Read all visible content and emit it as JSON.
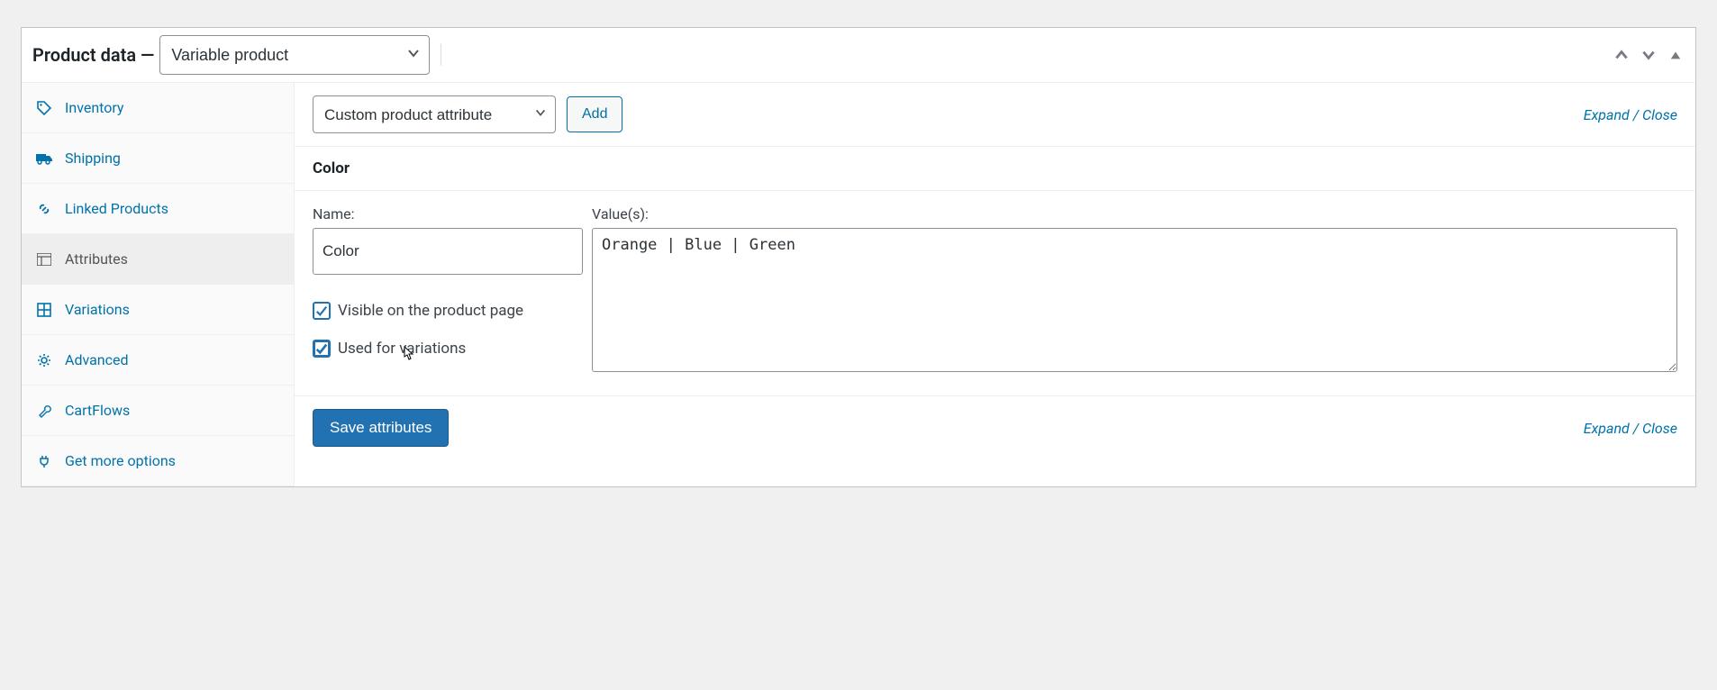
{
  "header": {
    "title_prefix": "Product data —",
    "product_type": "Variable product"
  },
  "tabs": {
    "inventory": "Inventory",
    "shipping": "Shipping",
    "linked": "Linked Products",
    "attributes": "Attributes",
    "variations": "Variations",
    "advanced": "Advanced",
    "cartflows": "CartFlows",
    "more": "Get more options"
  },
  "toolbar": {
    "attr_type": "Custom product attribute",
    "add_label": "Add",
    "expand_close": "Expand / Close"
  },
  "attribute": {
    "heading": "Color",
    "name_label": "Name:",
    "name_value": "Color",
    "values_label": "Value(s):",
    "values_value": "Orange | Blue | Green",
    "visible_label": "Visible on the product page",
    "variations_label": "Used for variations",
    "visible_checked": true,
    "variations_checked": true
  },
  "footer": {
    "save_label": "Save attributes",
    "expand_close": "Expand / Close"
  }
}
